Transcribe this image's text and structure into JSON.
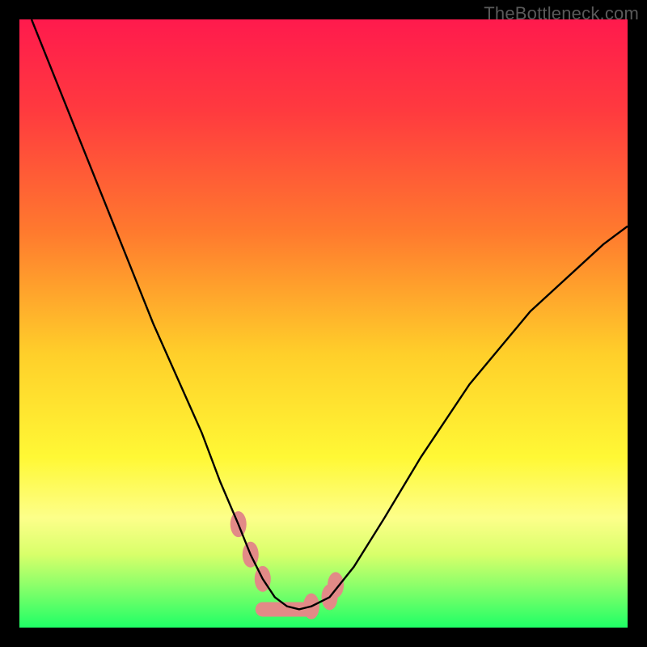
{
  "watermark": "TheBottleneck.com",
  "chart_data": {
    "type": "line",
    "title": "",
    "xlabel": "",
    "ylabel": "",
    "xlim": [
      0,
      100
    ],
    "ylim": [
      0,
      100
    ],
    "background_gradient": {
      "stops": [
        {
          "offset": 0.0,
          "color": "#ff1a4d"
        },
        {
          "offset": 0.15,
          "color": "#ff3a3f"
        },
        {
          "offset": 0.35,
          "color": "#ff7a2e"
        },
        {
          "offset": 0.55,
          "color": "#ffcf2a"
        },
        {
          "offset": 0.72,
          "color": "#fff835"
        },
        {
          "offset": 0.82,
          "color": "#fdff8a"
        },
        {
          "offset": 0.88,
          "color": "#d8ff6a"
        },
        {
          "offset": 0.93,
          "color": "#8dff6a"
        },
        {
          "offset": 1.0,
          "color": "#1fff66"
        }
      ]
    },
    "series": [
      {
        "name": "curve",
        "color": "#000000",
        "x": [
          2,
          6,
          10,
          14,
          18,
          22,
          26,
          30,
          33,
          36,
          38,
          40,
          42,
          44,
          46,
          48,
          51,
          55,
          60,
          66,
          74,
          84,
          96,
          100
        ],
        "y": [
          100,
          90,
          80,
          70,
          60,
          50,
          41,
          32,
          24,
          17,
          12,
          8,
          5,
          3.5,
          3,
          3.5,
          5,
          10,
          18,
          28,
          40,
          52,
          63,
          66
        ]
      }
    ],
    "markers": {
      "color": "#e28a87",
      "points": [
        {
          "x": 36,
          "y": 17
        },
        {
          "x": 38,
          "y": 12
        },
        {
          "x": 40,
          "y": 8
        },
        {
          "x": 48,
          "y": 3.5
        },
        {
          "x": 51,
          "y": 5
        },
        {
          "x": 52,
          "y": 7
        }
      ],
      "flat_segment": {
        "x0": 40,
        "x1": 48,
        "y": 3
      }
    }
  }
}
